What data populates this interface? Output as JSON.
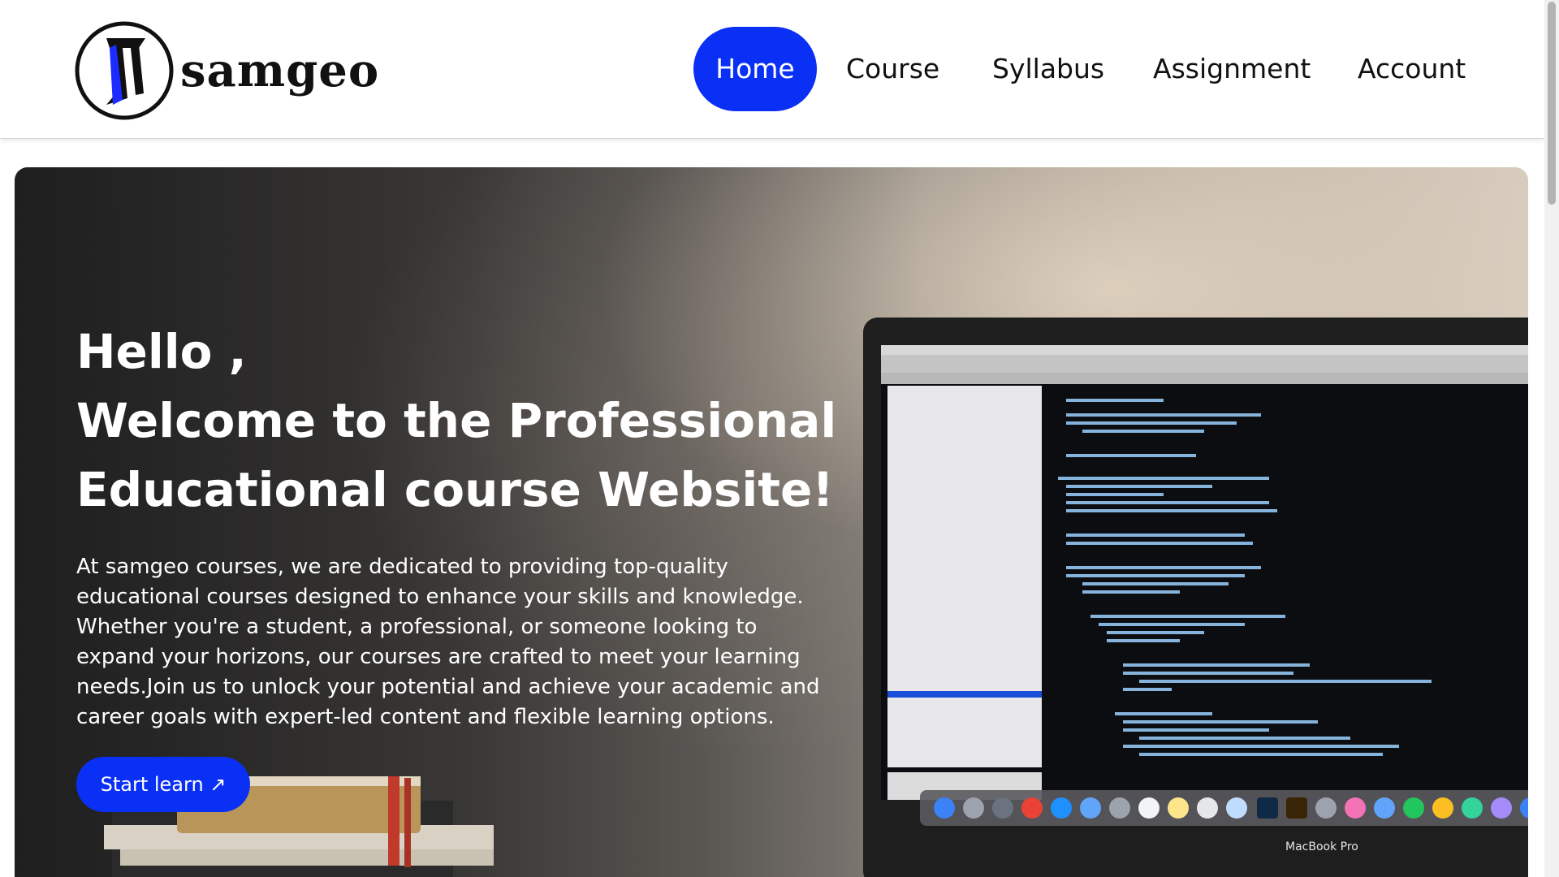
{
  "brand": {
    "name": "samgeo",
    "logo_icon": "samgeo-s-logo",
    "accent": "#0a2ff5"
  },
  "nav": {
    "items": [
      {
        "label": "Home",
        "active": true
      },
      {
        "label": "Course",
        "active": false
      },
      {
        "label": "Syllabus",
        "active": false
      },
      {
        "label": "Assignment",
        "active": false
      },
      {
        "label": "Account",
        "active": false
      }
    ]
  },
  "hero": {
    "greeting": "Hello ,",
    "title_line1": "Welcome to the Professional",
    "title_line2": "Educational course Website!",
    "description": "At samgeo courses, we are dedicated to providing top-quality educational courses designed to enhance your skills and knowledge. Whether you're a student, a professional, or someone looking to expand your horizons, our courses are crafted to meet your learning needs.Join us to unlock your potential and achieve your academic and career goals with expert-led content and flexible learning options.",
    "cta_label": "Start learn ↗",
    "laptop_brand": "MacBook Pro"
  }
}
